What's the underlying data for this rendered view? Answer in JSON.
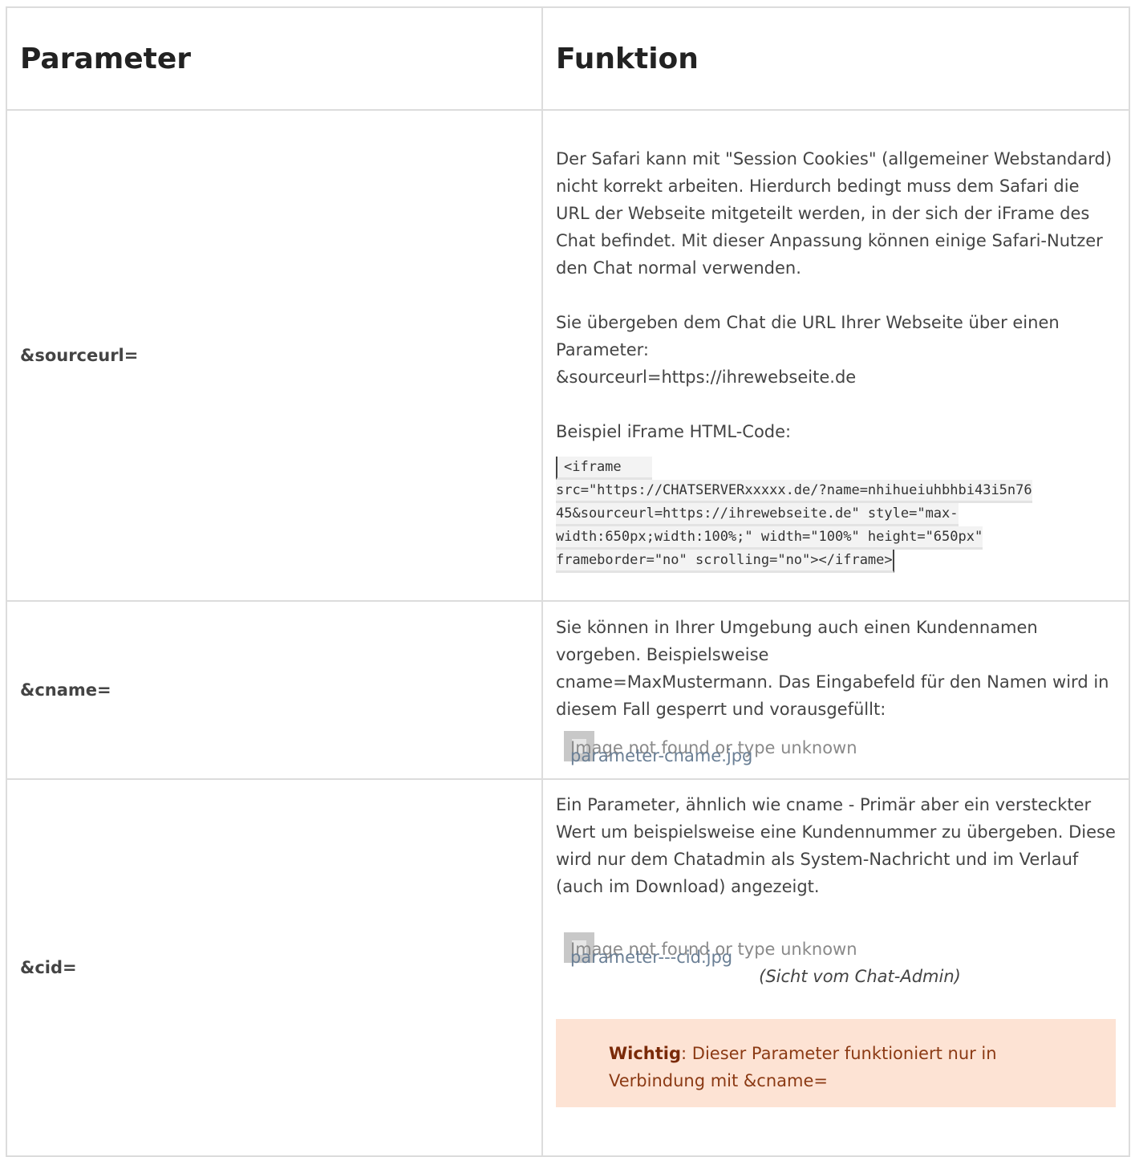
{
  "table": {
    "headers": [
      "Parameter",
      "Funktion"
    ],
    "rows": [
      {
        "param": "&sourceurl=",
        "paragraphs": [
          "Der Safari kann mit \"Session Cookies\" (allgemeiner Webstandard) nicht korrekt arbeiten. Hierdurch bedingt muss dem Safari die URL der Webseite mitgeteilt werden, in der sich der iFrame des Chat befindet. Mit dieser Anpassung können einige Safari-Nutzer den Chat normal verwenden.",
          "Sie übergeben dem Chat die URL Ihrer Webseite über einen Parameter:",
          "&sourceurl=https://ihrewebseite.de",
          "Beispiel iFrame HTML-Code:"
        ],
        "code_lines": [
          "<iframe ",
          "src=\"https://CHATSERVERxxxxx.de/?name=nhihueiuhbhbi43i5n76",
          "45&sourceurl=https://ihrewebseite.de\" style=\"max-",
          "width:650px;width:100%;\" width=\"100%\" height=\"650px\"",
          "frameborder=\"no\" scrolling=\"no\"></iframe>"
        ]
      },
      {
        "param": "&cname=",
        "paragraphs": [
          "Sie können in Ihrer Umgebung auch einen Kundennamen vorgeben. Beispielsweise",
          "cname=MaxMustermann. Das Eingabefeld für den Namen wird in diesem Fall gesperrt und vorausgefüllt:"
        ],
        "image": {
          "alt": "Image not found or type unknown",
          "link": "parameter-cname.jpg"
        }
      },
      {
        "param": "&cid=",
        "paragraphs": [
          "Ein Parameter, ähnlich wie cname - Primär aber ein versteckter Wert um beispielsweise eine Kundennummer zu übergeben. Diese wird nur dem Chatadmin als System-Nachricht und im Verlauf (auch im Download) angezeigt."
        ],
        "image": {
          "alt": "Image not found or type unknown",
          "link": "parameter---cid.jpg"
        },
        "caption": "(Sicht vom Chat-Admin)",
        "callout": {
          "bold": "Wichtig",
          "text": ": Dieser Parameter funktioniert nur in Verbindung mit &cname="
        }
      }
    ]
  }
}
